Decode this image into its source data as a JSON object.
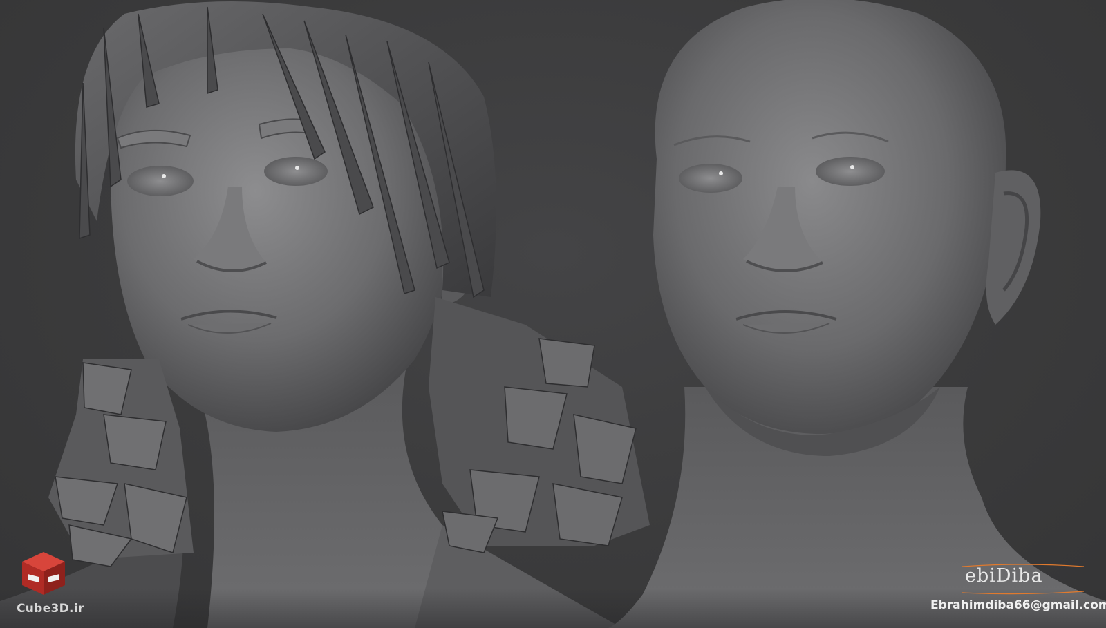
{
  "watermark_left": {
    "site": "Cube3D.ir"
  },
  "signature": {
    "text": "ebiDiba"
  },
  "email": "Ebrahimdiba66@gmail.com",
  "colors": {
    "background": "#3a3a3b",
    "clay": "#6e6e70",
    "logo_red": "#c8312b",
    "signature_accent": "#e07a2e"
  }
}
